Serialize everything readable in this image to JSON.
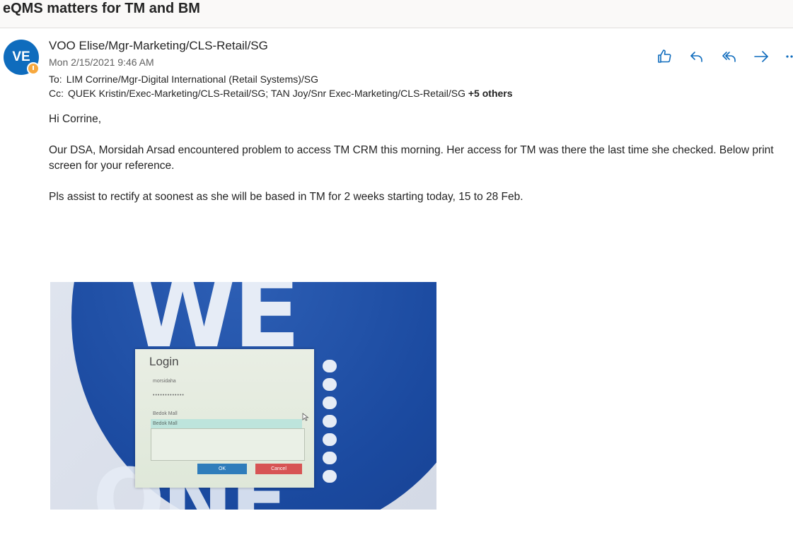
{
  "subject": "eQMS matters for TM and BM",
  "sender": {
    "initials": "VE",
    "name": "VOO Elise/Mgr-Marketing/CLS-Retail/SG",
    "date": "Mon 2/15/2021 9:46 AM",
    "avatar_color": "#0f6cbd"
  },
  "recipients": {
    "to_label": "To:",
    "to": "LIM Corrine/Mgr-Digital International (Retail Systems)/SG",
    "cc_label": "Cc:",
    "cc": "QUEK Kristin/Exec-Marketing/CLS-Retail/SG; TAN Joy/Snr Exec-Marketing/CLS-Retail/SG",
    "cc_more": "+5 others"
  },
  "actions": [
    {
      "icon": "like-icon"
    },
    {
      "icon": "reply-icon"
    },
    {
      "icon": "reply-all-icon"
    },
    {
      "icon": "forward-icon"
    },
    {
      "icon": "more-icon"
    }
  ],
  "body": {
    "greeting": "Hi Corrine,",
    "para1": "Our DSA, Morsidah Arsad encountered problem to access TM CRM this morning. Her access for TM was there the last time she checked. Below print screen for your reference.",
    "para2": "Pls assist to rectify at soonest as she will be based in TM for 2 weeks starting today, 15 to 28 Feb."
  },
  "screenshot": {
    "background_text": "WE",
    "background_text_2": "ONE",
    "login_title": "Login",
    "username": "morsidaha",
    "password": "•••••••••••••",
    "branch_label": "Bedok Mall",
    "branch_selected": "Bedok Mall",
    "ok_label": "OK",
    "cancel_label": "Cancel"
  },
  "accent_color": "#0f6cbd"
}
